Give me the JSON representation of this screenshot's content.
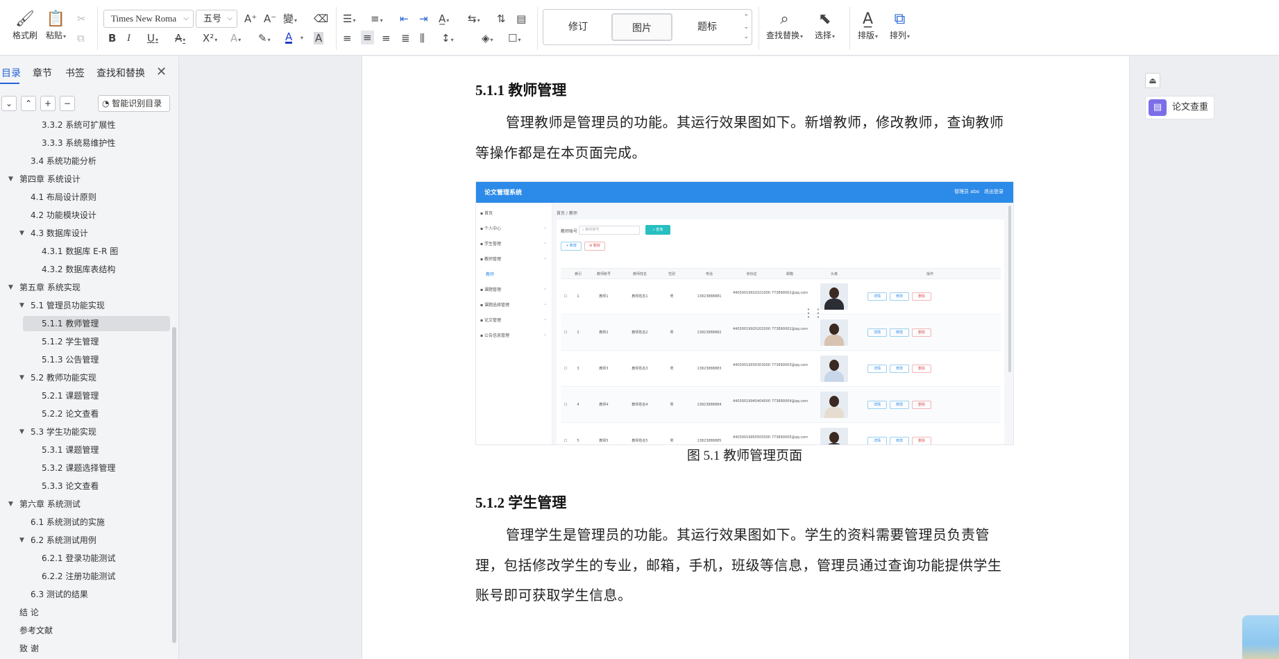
{
  "ribbon": {
    "format_painter": "格式刷",
    "paste": "粘贴",
    "font_name": "Times New Roma",
    "font_size": "五号",
    "styles": [
      "修订",
      "图片",
      "题标"
    ],
    "find_replace": "查找替换",
    "select": "选择",
    "layout": "排版",
    "arrange": "排列"
  },
  "sidebar": {
    "tabs": [
      "目录",
      "章节",
      "书签",
      "查找和替换"
    ],
    "smart_toc": "智能识别目录",
    "toc": [
      {
        "label": "3.3.2 系统可扩展性",
        "level": 3
      },
      {
        "label": "3.3.3 系统易维护性",
        "level": 3
      },
      {
        "label": "3.4 系统功能分析",
        "level": 2
      },
      {
        "label": "第四章  系统设计",
        "level": 1,
        "toggle": "▼"
      },
      {
        "label": "4.1 布局设计原则",
        "level": 2
      },
      {
        "label": "4.2 功能模块设计",
        "level": 2
      },
      {
        "label": "4.3 数据库设计",
        "level": 2,
        "toggle": "▼"
      },
      {
        "label": "4.3.1 数据库 E-R 图",
        "level": 3
      },
      {
        "label": "4.3.2  数据库表结构",
        "level": 3
      },
      {
        "label": "第五章  系统实现",
        "level": 1,
        "toggle": "▼"
      },
      {
        "label": "5.1  管理员功能实现",
        "level": 2,
        "toggle": "▼"
      },
      {
        "label": "5.1.1  教师管理",
        "level": 3,
        "selected": true
      },
      {
        "label": "5.1.2  学生管理",
        "level": 3
      },
      {
        "label": "5.1.3  公告管理",
        "level": 3
      },
      {
        "label": "5.2  教师功能实现",
        "level": 2,
        "toggle": "▼"
      },
      {
        "label": "5.2.1  课题管理",
        "level": 3
      },
      {
        "label": "5.2.2  论文查看",
        "level": 3
      },
      {
        "label": "5.3  学生功能实现",
        "level": 2,
        "toggle": "▼"
      },
      {
        "label": "5.3.1  课题管理",
        "level": 3
      },
      {
        "label": "5.3.2  课题选择管理",
        "level": 3
      },
      {
        "label": "5.3.3  论文查看",
        "level": 3
      },
      {
        "label": "第六章  系统测试",
        "level": 1,
        "toggle": "▼"
      },
      {
        "label": "6.1  系统测试的实施",
        "level": 2
      },
      {
        "label": "6.2  系统测试用例",
        "level": 2,
        "toggle": "▼"
      },
      {
        "label": "6.2.1  登录功能测试",
        "level": 3
      },
      {
        "label": "6.2.2  注册功能测试",
        "level": 3
      },
      {
        "label": "6.3  测试的结果",
        "level": 2
      },
      {
        "label": "结   论",
        "level": 1
      },
      {
        "label": "参考文献",
        "level": 1
      },
      {
        "label": "致   谢",
        "level": 1
      }
    ]
  },
  "document": {
    "heading1": "5.1.1  教师管理",
    "para1": "管理教师是管理员的功能。其运行效果图如下。新增教师，修改教师，查询教师等操作都是在本页面完成。",
    "caption": "图 5.1  教师管理页面",
    "heading2": "5.1.2  学生管理",
    "para2": "管理学生是管理员的功能。其运行效果图如下。学生的资料需要管理员负责管理，包括修改学生的专业，邮箱，手机，班级等信息，管理员通过查询功能提供学生账号即可获取学生信息。"
  },
  "screenshot": {
    "app_title": "论文管理系统",
    "user": "管理员 abo",
    "logout": "退出登录",
    "menu": [
      "首页",
      "个人中心",
      "学生管理",
      "教师管理",
      "教师",
      "课题管理",
      "课题选择管理",
      "论文管理",
      "公告信息管理"
    ],
    "breadcrumb": "首页 / 教师",
    "search_label": "教师账号",
    "search_placeholder": "教师账号",
    "query": "查询",
    "add": "+ 新增",
    "delete": "删除",
    "columns": [
      "",
      "索引",
      "教师账号",
      "教师姓名",
      "性别",
      "电话",
      "身份证",
      "邮箱",
      "头像",
      "操作"
    ],
    "rows": [
      {
        "idx": "1",
        "acct": "教师1",
        "name": "教师姓名1",
        "sex": "男",
        "phone": "13823888881",
        "id": "440300199101010001",
        "email": "773890001@qq.com",
        "ava": "#2a2d33"
      },
      {
        "idx": "2",
        "acct": "教师2",
        "name": "教师姓名2",
        "sex": "男",
        "phone": "13823888882",
        "id": "440300199202020002",
        "email": "773890002@qq.com",
        "ava": "#d8c2b0"
      },
      {
        "idx": "3",
        "acct": "教师3",
        "name": "教师姓名3",
        "sex": "男",
        "phone": "13823888883",
        "id": "440300199303030003",
        "email": "773890003@qq.com",
        "ava": "#c7d6e8"
      },
      {
        "idx": "4",
        "acct": "教师4",
        "name": "教师姓名4",
        "sex": "男",
        "phone": "13823888884",
        "id": "440300199404040004",
        "email": "773890004@qq.com",
        "ava": "#e6dccf"
      },
      {
        "idx": "5",
        "acct": "教师5",
        "name": "教师姓名5",
        "sex": "男",
        "phone": "13823888885",
        "id": "440300199505050005",
        "email": "773890005@qq.com",
        "ava": "#32363c"
      }
    ],
    "row_actions": [
      "详情",
      "修改",
      "删除"
    ]
  },
  "right_panel": {
    "check": "论文查重"
  },
  "colors": {
    "accent": "#2563d6",
    "app_bar": "#2c8ae8",
    "teal": "#27bfc1",
    "check_icon": "#7b6ee8"
  }
}
